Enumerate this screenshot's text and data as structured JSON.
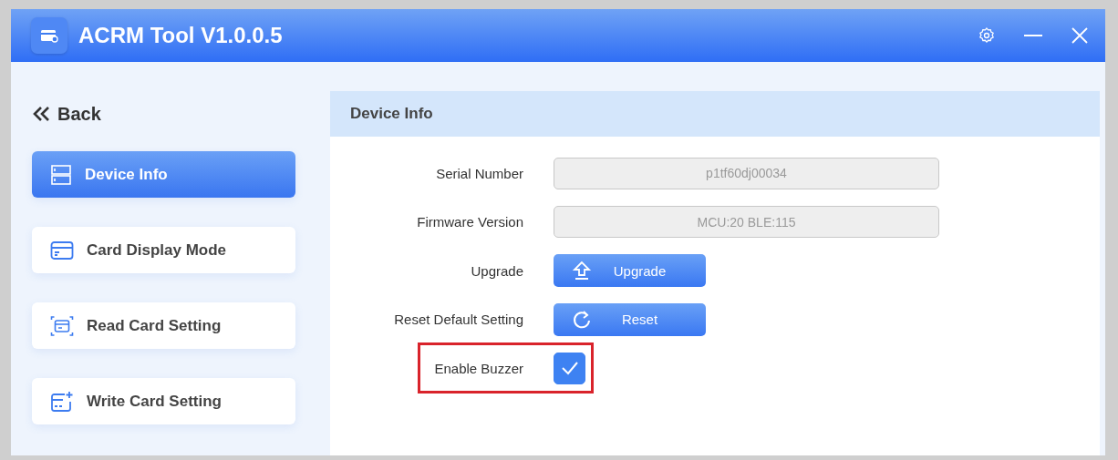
{
  "window": {
    "title": "ACRM Tool V1.0.0.5"
  },
  "back": {
    "label": "Back"
  },
  "sidebar": {
    "items": [
      {
        "label": "Device Info",
        "selected": true
      },
      {
        "label": "Card Display Mode",
        "selected": false
      },
      {
        "label": "Read Card Setting",
        "selected": false
      },
      {
        "label": "Write Card Setting",
        "selected": false
      }
    ]
  },
  "panel": {
    "title": "Device Info",
    "rows": [
      {
        "kind": "field",
        "label": "Serial Number",
        "value": "p1tf60dj00034",
        "highlighted": false
      },
      {
        "kind": "field",
        "label": "Firmware Version",
        "value": "MCU:20 BLE:115",
        "highlighted": false
      },
      {
        "kind": "button",
        "label": "Upgrade",
        "button": "Upgrade",
        "highlighted": false
      },
      {
        "kind": "button",
        "label": "Reset Default Setting",
        "button": "Reset",
        "highlighted": false
      },
      {
        "kind": "checkbox",
        "label": "Enable Buzzer",
        "checked": true,
        "highlighted": true
      }
    ]
  }
}
